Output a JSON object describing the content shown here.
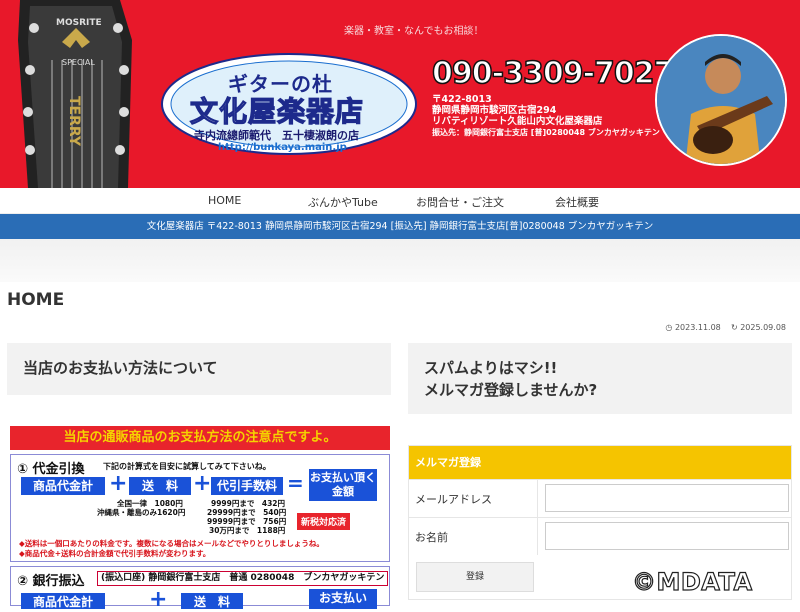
{
  "banner": {
    "tagline": "楽器・教室・なんでもお相談！",
    "logo_line1": "ギターの杜",
    "logo_line2": "文化屋楽器店",
    "logo_sub": "寺内流總師範代　五十棲淑朗の店",
    "logo_url": "http://bunkaya.main.jp",
    "phone": "090-3309-7027",
    "address_line1": "〒422-8013",
    "address_line2": "静岡県静岡市駿河区古宿294",
    "address_line3": "リバティリゾート久能山内文化屋楽器店",
    "address_line4": "振込先：静岡銀行富士支店 [普]0280048 ブンカヤガッキテン",
    "guitar_text1": "MOSRITE",
    "guitar_text2": "SPECIAL",
    "guitar_text3": "TERRY"
  },
  "nav": {
    "items": [
      {
        "label": "HOME"
      },
      {
        "label": "ぶんかやTube"
      },
      {
        "label": "お問合せ・ご注文"
      },
      {
        "label": "会社概要"
      }
    ]
  },
  "info_bar": "文化屋楽器店 〒422-8013 静岡県静岡市駿河区古宿294 [振込先] 静岡銀行富士支店[普]0280048 ブンカヤガッキテン",
  "page": {
    "title": "HOME",
    "published": "2023.11.08",
    "updated": "2025.09.08"
  },
  "left_box": "当店のお支払い方法について",
  "right_box": {
    "line1": "スパムよりはマシ!!",
    "line2": "メルマガ登録しませんか?"
  },
  "payment": {
    "header": "当店の通販商品のお支払方法の注意点ですよ。",
    "sec1_title": "① 代金引換",
    "sec1_note": "下記の計算式を目安に試算してみて下さいね。",
    "box_goods": "商品代金計",
    "box_shipping": "送　料",
    "box_fee": "代引手数料",
    "box_total": "お支払い頂く金額",
    "ship_rates_1": "全国一律　1080円",
    "ship_rates_2": "沖縄県・離島のみ1620円",
    "fee_1": "9999円まで　432円",
    "fee_2": "29999円まで　540円",
    "fee_3": "99999円まで　756円",
    "fee_4": "30万円まで　1188円",
    "tax_badge": "新税対応済",
    "note_1": "◆送料は一個口あたりの料金です。複数になる場合はメールなどでやりとりしましょうね。",
    "note_2": "◆商品代金+送料の合計金額で代引手数料が変わります。",
    "sec2_title": "② 銀行振込",
    "sec2_account": "(振込口座) 静岡銀行富士支店　普通 0280048　ブンカヤガッキテン",
    "box_goods2": "商品代金計",
    "box_shipping2": "送　料",
    "box_total2": "お支払い"
  },
  "mailmag": {
    "header": "メルマガ登録",
    "email_label": "メールアドレス",
    "name_label": "お名前",
    "submit": "登録"
  },
  "watermark": "©MDATA",
  "colors": {
    "banner_red": "#e8182a",
    "info_blue": "#2a6db6",
    "mailmag_yellow": "#f5c400"
  }
}
